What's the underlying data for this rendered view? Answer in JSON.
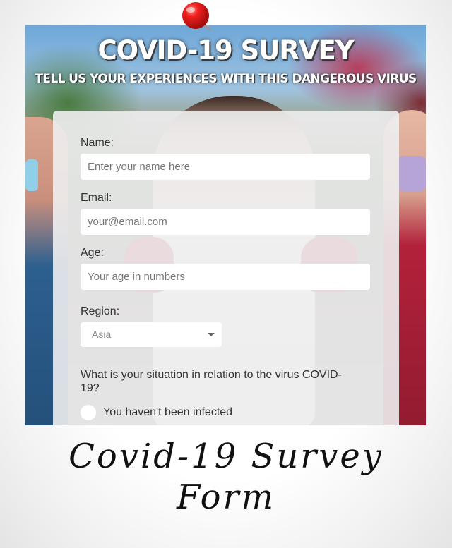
{
  "header": {
    "title": "COVID-19 SURVEY",
    "subtitle": "TELL US YOUR EXPERIENCES WITH THIS DANGEROUS VIRUS"
  },
  "form": {
    "name_label": "Name:",
    "name_placeholder": "Enter your name here",
    "email_label": "Email:",
    "email_placeholder": "your@email.com",
    "age_label": "Age:",
    "age_placeholder": "Your age in numbers",
    "region_label": "Region:",
    "region_selected": "Asia",
    "question": "What is your situation in relation to the virus COVID-19?",
    "radio_option_1": "You haven't been infected"
  },
  "caption": {
    "line1": "Covid-19 Survey",
    "line2": "Form"
  },
  "icons": {
    "pin": "push-pin-icon",
    "select_caret": "caret-down-icon"
  },
  "colors": {
    "pin_red": "#e8171b",
    "panel_bg": "#eeeef0"
  }
}
